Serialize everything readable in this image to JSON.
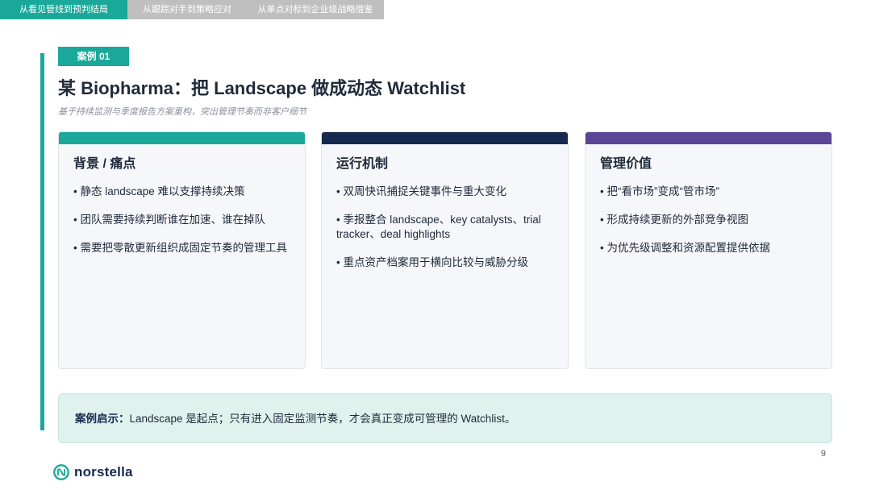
{
  "tabs": [
    {
      "label": "从看见管线到预判结局",
      "active": true
    },
    {
      "label": "从跟踪对手到策略应对",
      "active": false
    },
    {
      "label": "从单点对标到企业级战略借鉴",
      "active": false
    }
  ],
  "header": {
    "badge": "案例 01",
    "title": "某 Biopharma：把 Landscape 做成动态 Watchlist",
    "subtitle": "基于持续监测与季度报告方案重构，突出管理节奏而非客户细节"
  },
  "cards": [
    {
      "title": "背景 / 痛点",
      "color": "#1aa89a",
      "items": [
        "• 静态 landscape 难以支撑持续决策",
        "• 团队需要持续判断谁在加速、谁在掉队",
        "• 需要把零散更新组织成固定节奏的管理工具"
      ]
    },
    {
      "title": "运行机制",
      "color": "#16294f",
      "items": [
        "• 双周快讯捕捉关键事件与重大变化",
        "• 季报整合 landscape、key catalysts、trial tracker、deal highlights",
        "• 重点资产档案用于横向比较与威胁分级"
      ]
    },
    {
      "title": "管理价值",
      "color": "#5a4596",
      "items": [
        "• 把“看市场”变成“管市场”",
        "• 形成持续更新的外部竞争视图",
        "• 为优先级调整和资源配置提供依据"
      ]
    }
  ],
  "insight": {
    "label": "案例启示：",
    "text": "Landscape 是起点；只有进入固定监测节奏，才会真正变成可管理的 Watchlist。"
  },
  "footer": {
    "page_number": "9",
    "logo_text": "norstella"
  }
}
